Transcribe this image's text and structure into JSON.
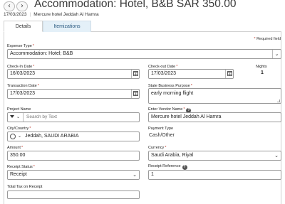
{
  "header": {
    "back_icon": "arrow-left-icon",
    "forward_icon": "arrow-right-icon",
    "title": "Accommodation: Hotel, B&B SAR 350.00",
    "date": "17/03/2023",
    "vendor": "Mercure hotel Jeddah Al Hamra"
  },
  "tabs": [
    {
      "label": "Details",
      "active": true
    },
    {
      "label": "Itemizations",
      "active": false
    }
  ],
  "required_note": "Required field",
  "form": {
    "expense_type": {
      "label": "Expense Type",
      "required": true,
      "value": "Accommodation: Hotel; B&B"
    },
    "check_in": {
      "label": "Check-In Date",
      "required": true,
      "value": "16/03/2023"
    },
    "check_out": {
      "label": "Check-out Date",
      "required": true,
      "value": "17/03/2023"
    },
    "nights": {
      "label": "Nights",
      "value": "1"
    },
    "transaction_date": {
      "label": "Transaction Date",
      "required": true,
      "value": "17/03/2023"
    },
    "business_purpose": {
      "label": "State Business Purpose",
      "required": true,
      "value": "early morning flight"
    },
    "project_name": {
      "label": "Project Name",
      "placeholder": "Search by Text"
    },
    "vendor_name": {
      "label": "Enter Vendor Name",
      "required": true,
      "value": "Mercure hotel Jeddah Al Hamra"
    },
    "city_country": {
      "label": "City/Country",
      "required": true,
      "value": "Jeddah, SAUDI ARABIA"
    },
    "payment_type": {
      "label": "Payment Type",
      "value": "Cash/Other"
    },
    "amount": {
      "label": "Amount",
      "required": true,
      "value": "350.00"
    },
    "currency": {
      "label": "Currency",
      "required": true,
      "value": "Saudi Arabia, Riyal"
    },
    "receipt_status": {
      "label": "Receipt Status",
      "required": true,
      "value": "Receipt"
    },
    "receipt_reference": {
      "label": "Receipt Reference",
      "value": "1"
    },
    "total_tax": {
      "label": "Total Tax on Receipt"
    }
  },
  "colors": {
    "required_star": "#c0392b",
    "tab_inactive_bg": "#e4f0f8"
  }
}
